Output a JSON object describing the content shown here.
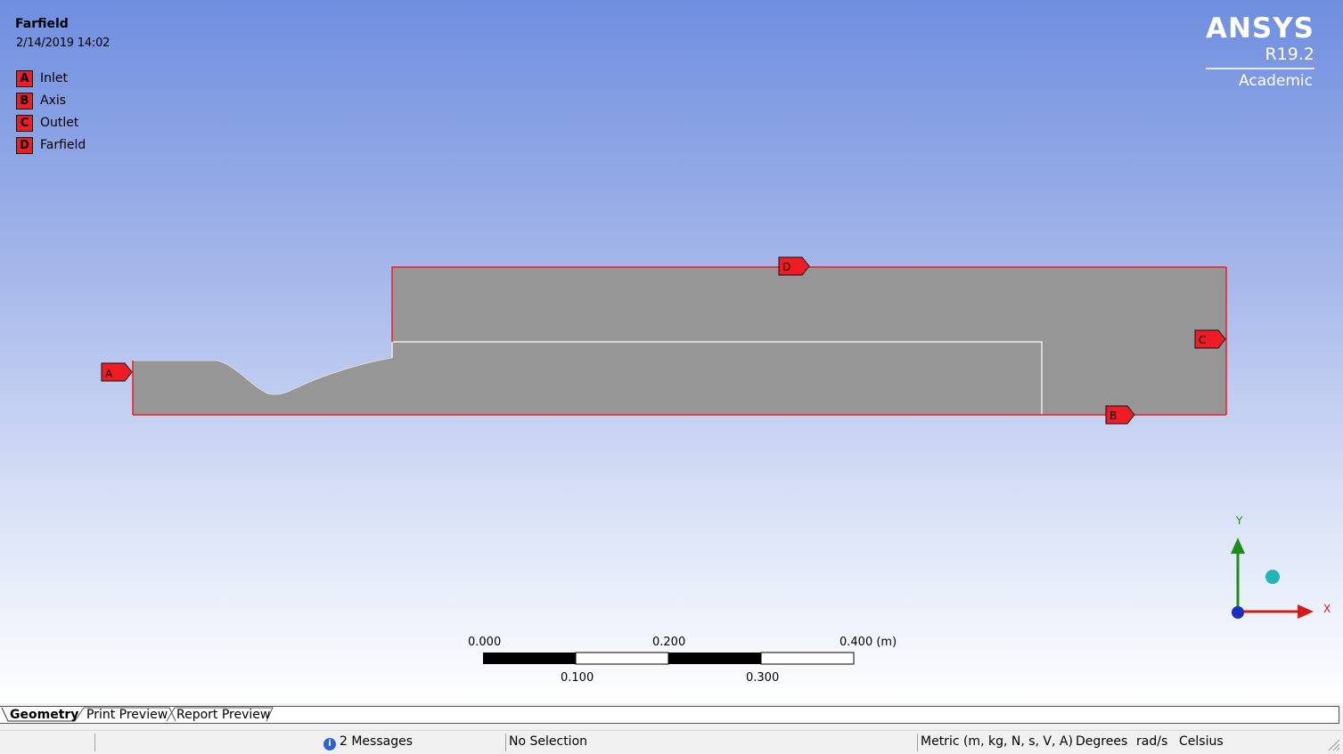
{
  "viewport": {
    "title": "Farfield",
    "datetime": "2/14/2019 14:02",
    "legend": [
      {
        "key": "A",
        "label": "Inlet"
      },
      {
        "key": "B",
        "label": "Axis"
      },
      {
        "key": "C",
        "label": "Outlet"
      },
      {
        "key": "D",
        "label": "Farfield"
      }
    ],
    "logo": {
      "name": "ANSYS",
      "version": "R19.2",
      "edition": "Academic"
    },
    "markers": {
      "a": "A",
      "b": "B",
      "c": "C",
      "d": "D"
    },
    "scale": {
      "l0": "0.000",
      "l1": "0.100",
      "l2": "0.200",
      "l3": "0.300",
      "l4": "0.400 (m)"
    },
    "triad": {
      "x": "X",
      "y": "Y"
    },
    "colors": {
      "selection": "#ee1c24",
      "body": "#969696",
      "edge": "#e8e8e8"
    }
  },
  "tabs": [
    "Geometry",
    "Print Preview",
    "Report Preview"
  ],
  "status": {
    "messages": "2 Messages",
    "selection": "No Selection",
    "units": "Metric (m, kg, N, s, V, A)",
    "angle": "Degrees",
    "angular_velocity": "rad/s",
    "temperature": "Celsius"
  }
}
